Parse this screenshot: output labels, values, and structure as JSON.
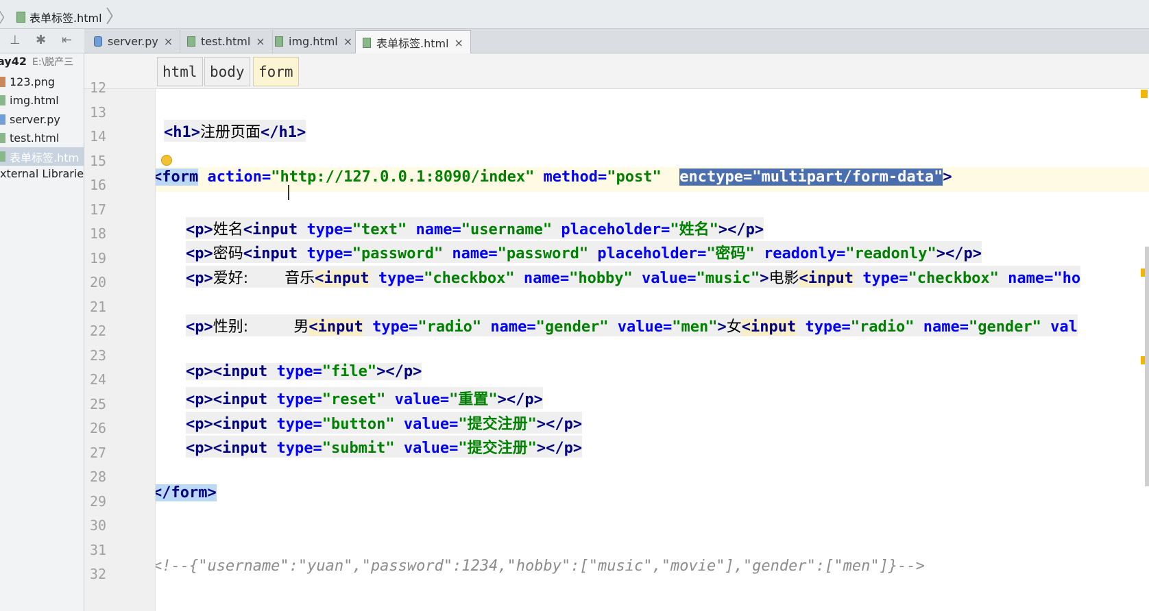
{
  "breadcrumb": {
    "file": "表单标签.html"
  },
  "toolbar": {
    "icons": [
      "collapse-icon",
      "settings-icon",
      "autoscroll-icon"
    ],
    "settings_glyph": "✱",
    "collapse_glyph": "⊥",
    "scroll_glyph": "⇤"
  },
  "tabs": [
    {
      "label": "server.py",
      "close": "×"
    },
    {
      "label": "test.html",
      "close": "×"
    },
    {
      "label": "img.html",
      "close": "×"
    },
    {
      "label": "表单标签.html",
      "close": "×"
    }
  ],
  "sidebar": {
    "project_name": "ay42",
    "project_path": "E:\\脱产三",
    "items": [
      {
        "label": "123.png"
      },
      {
        "label": "img.html"
      },
      {
        "label": "server.py"
      },
      {
        "label": "test.html"
      },
      {
        "label": "表单标签.htm"
      }
    ],
    "external": "xternal Librarie"
  },
  "tagpath": [
    "html",
    "body",
    "form"
  ],
  "editor": {
    "line_numbers": [
      "12",
      "13",
      "14",
      "15",
      "16",
      "17",
      "18",
      "19",
      "20",
      "21",
      "22",
      "23",
      "24",
      "25",
      "26",
      "27",
      "28",
      "29",
      "30",
      "31",
      "32"
    ],
    "code": {
      "h1_open": "<h1>",
      "h1_text": "注册页面",
      "h1_close": "</h1>",
      "form_open": "<form",
      "action_attr": " action=",
      "action_val": "\"http://127.0.0.1:8090/index\"",
      "method_attr": " method=",
      "method_val": "\"post\"",
      "space": " ",
      "enctype_attr": "enctype=",
      "enctype_val": "\"multipart/form-data\"",
      "gt": ">",
      "p_open": "<p>",
      "p_close": "></p>",
      "name_label": "姓名",
      "pwd_label": "密码",
      "input": "<input",
      "type": " type=",
      "name": " name=",
      "placeholder": " placeholder=",
      "value": " value=",
      "readonly": " readonly=",
      "v_text": "\"text\"",
      "v_username": "\"username\"",
      "v_xingming": "\"姓名\"",
      "v_password": "\"password\"",
      "v_mima": "\"密码\"",
      "v_readonly": "\"readonly\"",
      "hobby_label": "爱好:",
      "hobby_gap": "    ",
      "music_label": "音乐",
      "movie_label": "电影",
      "v_checkbox": "\"checkbox\"",
      "v_hobby": "\"hobby\"",
      "v_music": "\"music\"",
      "l20_tail": " name=\"ho",
      "gender_label": "性别:",
      "gender_gap": "     ",
      "male_label": "男",
      "female_label": "女",
      "v_radio": "\"radio\"",
      "v_gender": "\"gender\"",
      "v_men": "\"men\"",
      "l22_tail": " val",
      "p_input": "<p><input",
      "v_file": "\"file\"",
      "v_reset": "\"reset\"",
      "v_chongzhi": "\"重置\"",
      "v_button": "\"button\"",
      "v_tijiao": "\"提交注册\"",
      "v_submit": "\"submit\"",
      "form_close": "</form>",
      "comment": "<!--{\"username\":\"yuan\",\"password\":1234,\"hobby\":[\"music\",\"movie\"],\"gender\":[\"men\"]}-->"
    }
  }
}
